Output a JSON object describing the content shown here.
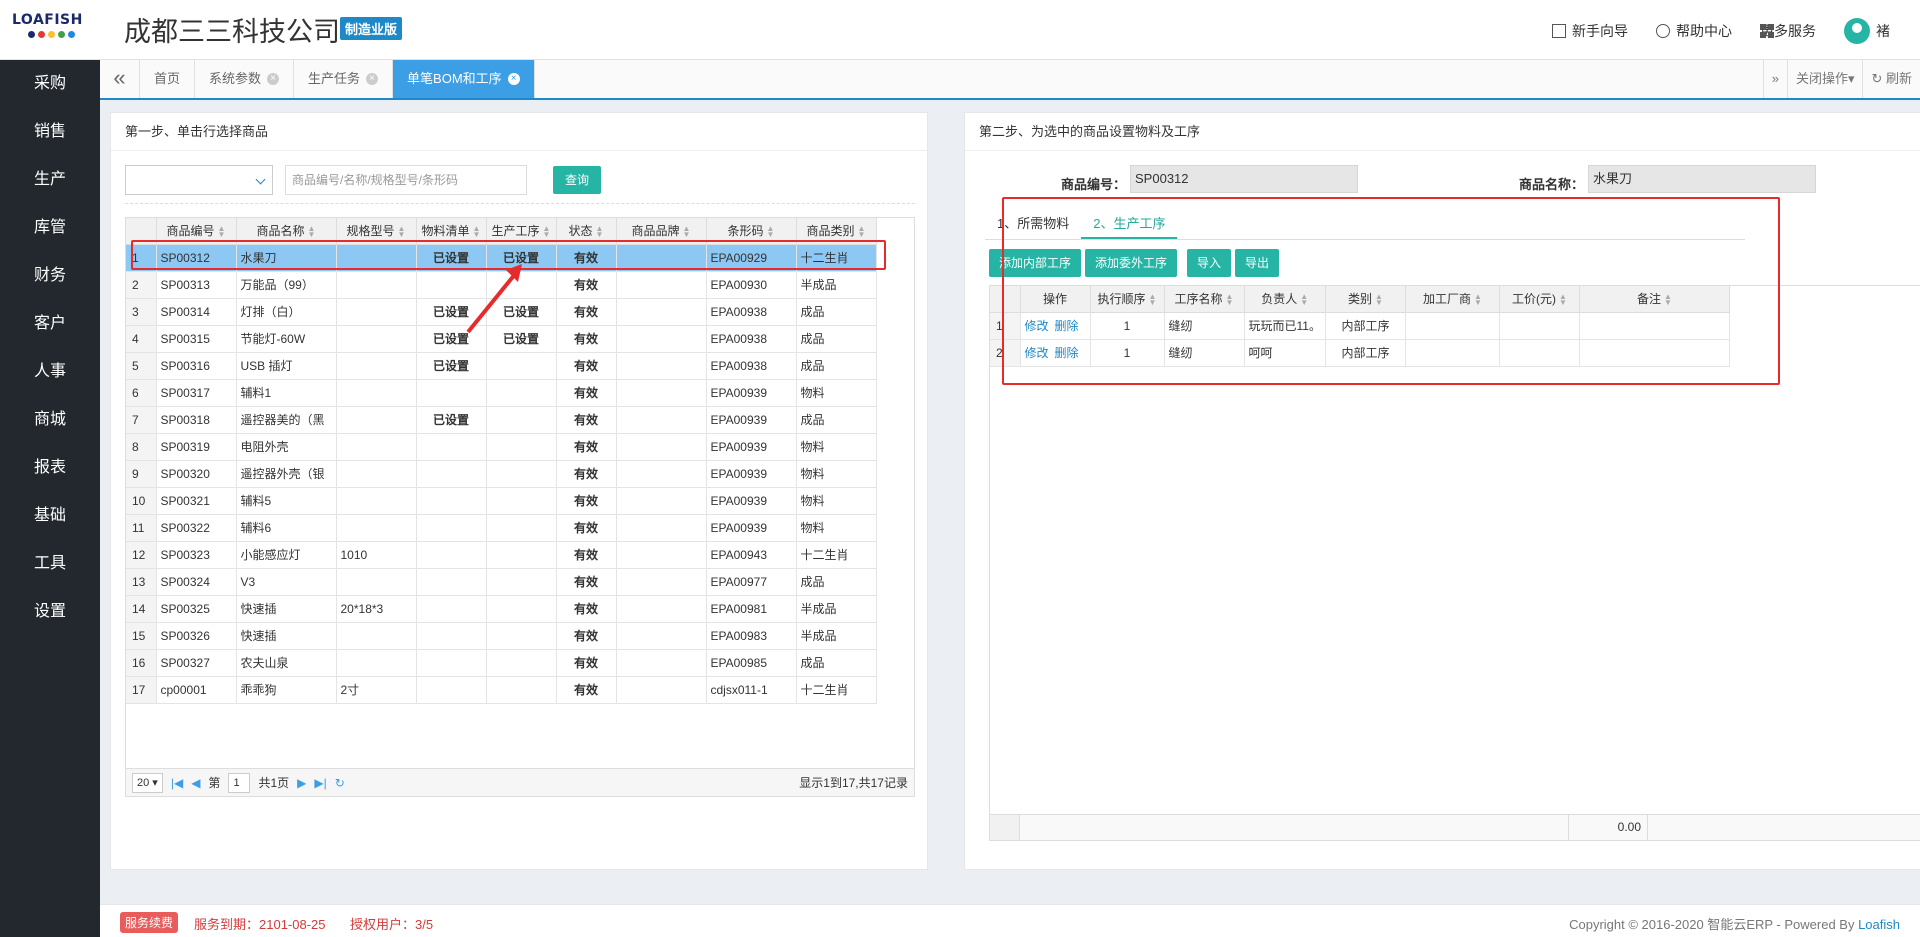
{
  "header": {
    "logo_text": "LOAFISH",
    "logo_dots": [
      "#1a2a6c",
      "#e53935",
      "#fbc02d",
      "#43a047",
      "#1e88e5"
    ],
    "company": "成都三三科技公司",
    "edition": "制造业版",
    "links": [
      {
        "name": "guide",
        "label": "新手向导"
      },
      {
        "name": "help",
        "label": "帮助中心"
      },
      {
        "name": "more",
        "label": "更多服务"
      }
    ],
    "user": "褚"
  },
  "sidebar": {
    "items": [
      "采购",
      "销售",
      "生产",
      "库管",
      "财务",
      "客户",
      "人事",
      "商城",
      "报表",
      "基础",
      "工具",
      "设置"
    ]
  },
  "tabs": {
    "items": [
      {
        "label": "首页",
        "closable": false,
        "active": false
      },
      {
        "label": "系统参数",
        "closable": true,
        "active": false
      },
      {
        "label": "生产任务",
        "closable": true,
        "active": false
      },
      {
        "label": "单笔BOM和工序",
        "closable": true,
        "active": true
      }
    ],
    "close_ops": "关闭操作▾",
    "refresh": "刷新"
  },
  "left": {
    "title": "第一步、单击行选择商品",
    "search_placeholder": "商品编号/名称/规格型号/条形码",
    "query_label": "查询",
    "columns": [
      "商品编号",
      "商品名称",
      "规格型号",
      "物料清单",
      "生产工序",
      "状态",
      "商品品牌",
      "条形码",
      "商品类别"
    ],
    "rows": [
      [
        "1",
        "SP00312",
        "水果刀",
        "",
        "已设置",
        "已设置",
        "有效",
        "",
        "EPA00929",
        "十二生肖"
      ],
      [
        "2",
        "SP00313",
        "万能品（99）",
        "",
        "",
        "",
        "有效",
        "",
        "EPA00930",
        "半成品"
      ],
      [
        "3",
        "SP00314",
        "灯排（白）",
        "",
        "已设置",
        "已设置",
        "有效",
        "",
        "EPA00938",
        "成品"
      ],
      [
        "4",
        "SP00315",
        "节能灯-60W",
        "",
        "已设置",
        "已设置",
        "有效",
        "",
        "EPA00938",
        "成品"
      ],
      [
        "5",
        "SP00316",
        "USB 插灯",
        "",
        "已设置",
        "",
        "有效",
        "",
        "EPA00938",
        "成品"
      ],
      [
        "6",
        "SP00317",
        "辅料1",
        "",
        "",
        "",
        "有效",
        "",
        "EPA00939",
        "物料"
      ],
      [
        "7",
        "SP00318",
        "遥控器美的（黑",
        "",
        "已设置",
        "",
        "有效",
        "",
        "EPA00939",
        "成品"
      ],
      [
        "8",
        "SP00319",
        "电阻外壳",
        "",
        "",
        "",
        "有效",
        "",
        "EPA00939",
        "物料"
      ],
      [
        "9",
        "SP00320",
        "遥控器外壳（银",
        "",
        "",
        "",
        "有效",
        "",
        "EPA00939",
        "物料"
      ],
      [
        "10",
        "SP00321",
        "辅料5",
        "",
        "",
        "",
        "有效",
        "",
        "EPA00939",
        "物料"
      ],
      [
        "11",
        "SP00322",
        "辅料6",
        "",
        "",
        "",
        "有效",
        "",
        "EPA00939",
        "物料"
      ],
      [
        "12",
        "SP00323",
        "小能感应灯",
        "1010",
        "",
        "",
        "有效",
        "",
        "EPA00943",
        "十二生肖"
      ],
      [
        "13",
        "SP00324",
        "V3",
        "",
        "",
        "",
        "有效",
        "",
        "EPA00977",
        "成品"
      ],
      [
        "14",
        "SP00325",
        "快速插",
        "20*18*3",
        "",
        "",
        "有效",
        "",
        "EPA00981",
        "半成品"
      ],
      [
        "15",
        "SP00326",
        "快速插",
        "",
        "",
        "",
        "有效",
        "",
        "EPA00983",
        "半成品"
      ],
      [
        "16",
        "SP00327",
        "农夫山泉",
        "",
        "",
        "",
        "有效",
        "",
        "EPA00985",
        "成品"
      ],
      [
        "17",
        "cp00001",
        "乖乖狗",
        "2寸",
        "",
        "",
        "有效",
        "",
        "cdjsx011-1",
        "十二生肖"
      ]
    ],
    "pager": {
      "page_size": "20",
      "page_prefix": "第",
      "page_value": "1",
      "page_total": "共1页",
      "info": "显示1到17,共17记录"
    }
  },
  "right": {
    "title": "第二步、为选中的商品设置物料及工序",
    "code_label": "商品编号：",
    "code_value": "SP00312",
    "name_label": "商品名称：",
    "name_value": "水果刀",
    "tabs": [
      "1、所需物料",
      "2、生产工序"
    ],
    "buttons": [
      "添加内部工序",
      "添加委外工序",
      "导入",
      "导出"
    ],
    "columns": [
      "操作",
      "执行顺序",
      "工序名称",
      "负责人",
      "类别",
      "加工厂商",
      "工价(元)",
      "备注"
    ],
    "edit_label": "修改",
    "delete_label": "删除",
    "rows": [
      {
        "num": "1",
        "order": "1",
        "process": "缝纫",
        "owner": "玩玩而已11。",
        "type": "内部工序",
        "vendor": "",
        "price": "",
        "note": ""
      },
      {
        "num": "2",
        "order": "1",
        "process": "缝纫",
        "owner": "呵呵",
        "type": "内部工序",
        "vendor": "",
        "price": "",
        "note": ""
      }
    ],
    "total": "0.00"
  },
  "footer": {
    "badge": "服务续费",
    "expire": "服务到期：2101-08-25",
    "users": "授权用户：3/5",
    "copyright": "Copyright © 2016-2020 智能云ERP - Powered By ",
    "brand": "Loafish"
  }
}
